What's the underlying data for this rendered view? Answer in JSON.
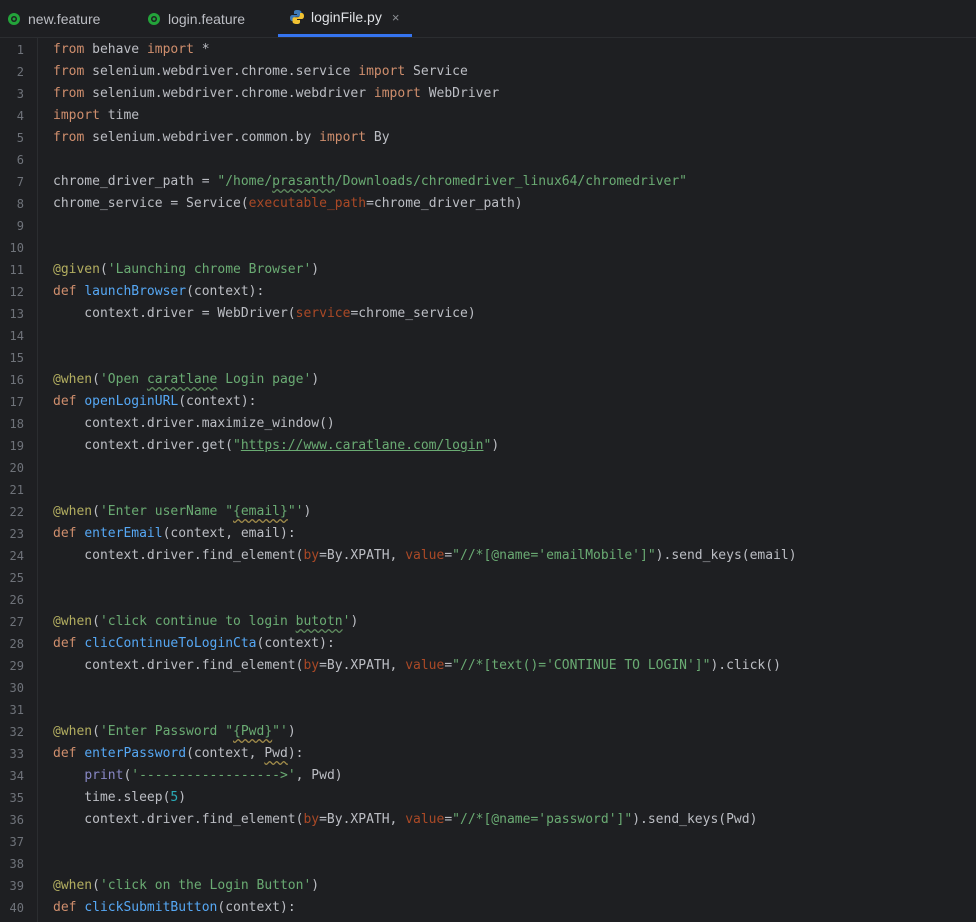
{
  "tabs": [
    {
      "label": "new.feature",
      "icon": "cucumber-icon",
      "active": false
    },
    {
      "label": "login.feature",
      "icon": "cucumber-icon",
      "active": false
    },
    {
      "label": "loginFile.py",
      "icon": "python-icon",
      "active": true,
      "close": "×"
    }
  ],
  "colors": {
    "background": "#1e1f22",
    "keyword": "#cf8e6d",
    "function": "#56a8f5",
    "string": "#6aab73",
    "decorator": "#b3ae60",
    "param": "#aa4926",
    "active_tab_underline": "#3574f0"
  },
  "code": {
    "lines": [
      {
        "n": "1",
        "tokens": [
          [
            "kw",
            "from"
          ],
          [
            "pl",
            " behave "
          ],
          [
            "kw",
            "import"
          ],
          [
            "pl",
            " *"
          ]
        ]
      },
      {
        "n": "2",
        "tokens": [
          [
            "kw",
            "from"
          ],
          [
            "pl",
            " selenium.webdriver.chrome.service "
          ],
          [
            "kw",
            "import"
          ],
          [
            "pl",
            " Service"
          ]
        ]
      },
      {
        "n": "3",
        "tokens": [
          [
            "kw",
            "from"
          ],
          [
            "pl",
            " selenium.webdriver.chrome.webdriver "
          ],
          [
            "kw",
            "import"
          ],
          [
            "pl",
            " WebDriver"
          ]
        ]
      },
      {
        "n": "4",
        "tokens": [
          [
            "kw",
            "import"
          ],
          [
            "pl",
            " time"
          ]
        ]
      },
      {
        "n": "5",
        "tokens": [
          [
            "kw",
            "from"
          ],
          [
            "pl",
            " selenium.webdriver.common.by "
          ],
          [
            "kw",
            "import"
          ],
          [
            "pl",
            " By"
          ]
        ]
      },
      {
        "n": "6",
        "tokens": []
      },
      {
        "n": "7",
        "tokens": [
          [
            "pl",
            "chrome_driver_path = "
          ],
          [
            "str",
            "\"/home/"
          ],
          [
            "str typo",
            "prasanth"
          ],
          [
            "str",
            "/Downloads/chromedriver_linux64/chromedriver\""
          ]
        ]
      },
      {
        "n": "8",
        "tokens": [
          [
            "pl",
            "chrome_service = Service("
          ],
          [
            "prm",
            "executable_path"
          ],
          [
            "pl",
            "=chrome_driver_path)"
          ]
        ]
      },
      {
        "n": "9",
        "tokens": []
      },
      {
        "n": "10",
        "tokens": []
      },
      {
        "n": "11",
        "tokens": [
          [
            "dec",
            "@given"
          ],
          [
            "pl",
            "("
          ],
          [
            "str",
            "'Launching chrome Browser'"
          ],
          [
            "pl",
            ")"
          ]
        ]
      },
      {
        "n": "12",
        "tokens": [
          [
            "kw",
            "def"
          ],
          [
            "pl",
            " "
          ],
          [
            "fn",
            "launchBrowser"
          ],
          [
            "pl",
            "(context):"
          ]
        ]
      },
      {
        "n": "13",
        "tokens": [
          [
            "pl",
            "    context.driver = WebDriver("
          ],
          [
            "prm",
            "service"
          ],
          [
            "pl",
            "=chrome_service)"
          ]
        ]
      },
      {
        "n": "14",
        "tokens": []
      },
      {
        "n": "15",
        "tokens": []
      },
      {
        "n": "16",
        "tokens": [
          [
            "dec",
            "@when"
          ],
          [
            "pl",
            "("
          ],
          [
            "str",
            "'Open "
          ],
          [
            "str typo",
            "caratlane"
          ],
          [
            "str",
            " Login page'"
          ],
          [
            "pl",
            ")"
          ]
        ]
      },
      {
        "n": "17",
        "tokens": [
          [
            "kw",
            "def"
          ],
          [
            "pl",
            " "
          ],
          [
            "fn",
            "openLoginURL"
          ],
          [
            "pl",
            "(context):"
          ]
        ]
      },
      {
        "n": "18",
        "tokens": [
          [
            "pl",
            "    context.driver.maximize_window()"
          ]
        ]
      },
      {
        "n": "19",
        "tokens": [
          [
            "pl",
            "    context.driver.get("
          ],
          [
            "str",
            "\""
          ],
          [
            "str url",
            "https://www.caratlane.com/login"
          ],
          [
            "str",
            "\""
          ],
          [
            "pl",
            ")"
          ]
        ]
      },
      {
        "n": "20",
        "tokens": []
      },
      {
        "n": "21",
        "tokens": []
      },
      {
        "n": "22",
        "tokens": [
          [
            "dec",
            "@when"
          ],
          [
            "pl",
            "("
          ],
          [
            "str",
            "'Enter userName \""
          ],
          [
            "str typo2",
            "{email}"
          ],
          [
            "str",
            "\"'"
          ],
          [
            "pl",
            ")"
          ]
        ]
      },
      {
        "n": "23",
        "tokens": [
          [
            "kw",
            "def"
          ],
          [
            "pl",
            " "
          ],
          [
            "fn",
            "enterEmail"
          ],
          [
            "pl",
            "(context, email):"
          ]
        ]
      },
      {
        "n": "24",
        "tokens": [
          [
            "pl",
            "    context.driver.find_element("
          ],
          [
            "prm",
            "by"
          ],
          [
            "pl",
            "=By.XPATH, "
          ],
          [
            "prm",
            "value"
          ],
          [
            "pl",
            "="
          ],
          [
            "str",
            "\"//*[@name='emailMobile']\""
          ],
          [
            "pl",
            ").send_keys(email)"
          ]
        ]
      },
      {
        "n": "25",
        "tokens": []
      },
      {
        "n": "26",
        "tokens": []
      },
      {
        "n": "27",
        "tokens": [
          [
            "dec",
            "@when"
          ],
          [
            "pl",
            "("
          ],
          [
            "str",
            "'click continue to login "
          ],
          [
            "str typo",
            "butotn"
          ],
          [
            "str",
            "'"
          ],
          [
            "pl",
            ")"
          ]
        ]
      },
      {
        "n": "28",
        "tokens": [
          [
            "kw",
            "def"
          ],
          [
            "pl",
            " "
          ],
          [
            "fn",
            "clicContinueToLoginCta"
          ],
          [
            "pl",
            "(context):"
          ]
        ]
      },
      {
        "n": "29",
        "tokens": [
          [
            "pl",
            "    context.driver.find_element("
          ],
          [
            "prm",
            "by"
          ],
          [
            "pl",
            "=By.XPATH, "
          ],
          [
            "prm",
            "value"
          ],
          [
            "pl",
            "="
          ],
          [
            "str",
            "\"//*[text()='CONTINUE TO LOGIN']\""
          ],
          [
            "pl",
            ").click()"
          ]
        ]
      },
      {
        "n": "30",
        "tokens": []
      },
      {
        "n": "31",
        "tokens": []
      },
      {
        "n": "32",
        "tokens": [
          [
            "dec",
            "@when"
          ],
          [
            "pl",
            "("
          ],
          [
            "str",
            "'Enter Password \""
          ],
          [
            "str typo2",
            "{Pwd}"
          ],
          [
            "str",
            "\"'"
          ],
          [
            "pl",
            ")"
          ]
        ]
      },
      {
        "n": "33",
        "tokens": [
          [
            "kw",
            "def"
          ],
          [
            "pl",
            " "
          ],
          [
            "fn",
            "enterPassword"
          ],
          [
            "pl",
            "(context, "
          ],
          [
            "pl typo2",
            "Pwd"
          ],
          [
            "pl",
            "):"
          ]
        ]
      },
      {
        "n": "34",
        "tokens": [
          [
            "pl",
            "    "
          ],
          [
            "bi",
            "print"
          ],
          [
            "pl",
            "("
          ],
          [
            "str",
            "'------------------>'"
          ],
          [
            "pl",
            ", Pwd)"
          ]
        ]
      },
      {
        "n": "35",
        "tokens": [
          [
            "pl",
            "    time.sleep("
          ],
          [
            "num",
            "5"
          ],
          [
            "pl",
            ")"
          ]
        ]
      },
      {
        "n": "36",
        "tokens": [
          [
            "pl",
            "    context.driver.find_element("
          ],
          [
            "prm",
            "by"
          ],
          [
            "pl",
            "=By.XPATH, "
          ],
          [
            "prm",
            "value"
          ],
          [
            "pl",
            "="
          ],
          [
            "str",
            "\"//*[@name='password']\""
          ],
          [
            "pl",
            ").send_keys(Pwd)"
          ]
        ]
      },
      {
        "n": "37",
        "tokens": []
      },
      {
        "n": "38",
        "tokens": []
      },
      {
        "n": "39",
        "tokens": [
          [
            "dec",
            "@when"
          ],
          [
            "pl",
            "("
          ],
          [
            "str",
            "'click on the Login Button'"
          ],
          [
            "pl",
            ")"
          ]
        ]
      },
      {
        "n": "40",
        "tokens": [
          [
            "kw",
            "def"
          ],
          [
            "pl",
            " "
          ],
          [
            "fn",
            "clickSubmitButton"
          ],
          [
            "pl",
            "(context):"
          ]
        ]
      }
    ]
  }
}
